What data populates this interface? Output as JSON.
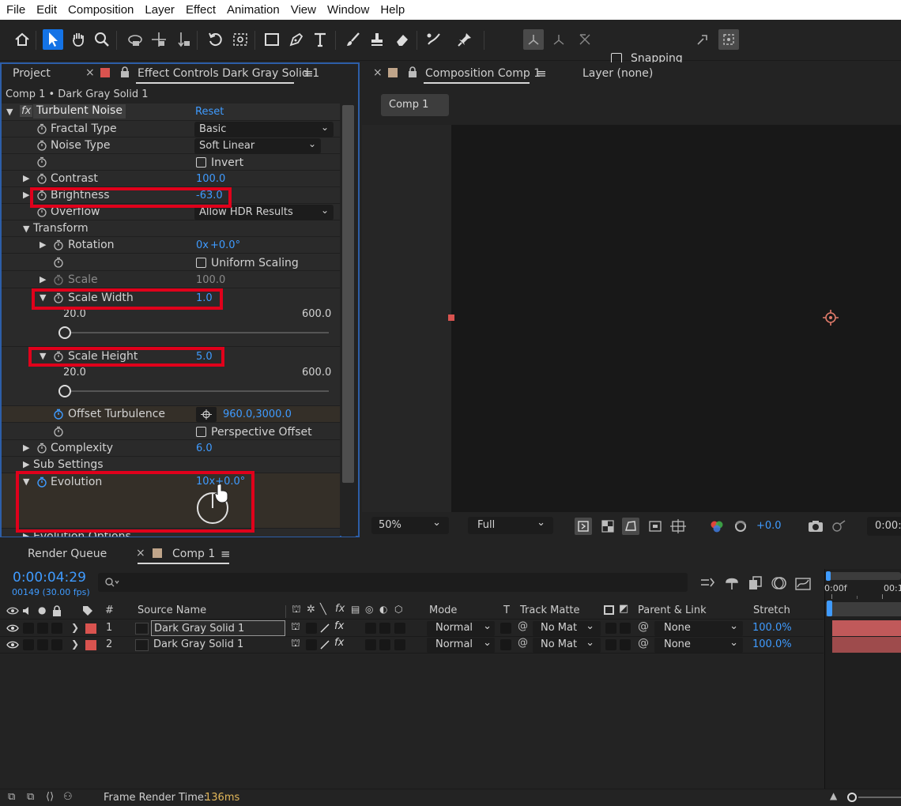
{
  "menu": [
    "File",
    "Edit",
    "Composition",
    "Layer",
    "Effect",
    "Animation",
    "View",
    "Window",
    "Help"
  ],
  "toolbar": {
    "snapping_label": "Snapping"
  },
  "left_panel": {
    "tab_project": "Project",
    "tab_effect_controls": "Effect Controls Dark Gray Solid 1",
    "breadcrumb": "Comp 1 • Dark Gray Solid 1"
  },
  "effect": {
    "name": "Turbulent Noise",
    "fx_label": "fx",
    "reset_label": "Reset",
    "fractal_type": {
      "label": "Fractal Type",
      "value": "Basic"
    },
    "noise_type": {
      "label": "Noise Type",
      "value": "Soft Linear"
    },
    "invert": {
      "label": "Invert",
      "checked": false
    },
    "contrast": {
      "label": "Contrast",
      "value": "100.0"
    },
    "brightness": {
      "label": "Brightness",
      "value": "-63.0"
    },
    "overflow": {
      "label": "Overflow",
      "value": "Allow HDR Results"
    },
    "transform": {
      "label": "Transform"
    },
    "rotation": {
      "label": "Rotation",
      "value_prefix": "0x",
      "value_suffix": "+0.0°"
    },
    "uniform_scaling": {
      "label": "Uniform Scaling",
      "checked": false
    },
    "scale": {
      "label": "Scale",
      "value": "100.0"
    },
    "scale_width": {
      "label": "Scale Width",
      "value": "1.0",
      "min": "20.0",
      "max": "600.0",
      "slider_fraction": 0.0
    },
    "scale_height": {
      "label": "Scale Height",
      "value": "5.0",
      "min": "20.0",
      "max": "600.0",
      "slider_fraction": 0.0
    },
    "offset_turbulence": {
      "label": "Offset Turbulence",
      "value": "960.0,3000.0"
    },
    "perspective_offset": {
      "label": "Perspective Offset",
      "checked": false
    },
    "complexity": {
      "label": "Complexity",
      "value": "6.0"
    },
    "sub_settings": {
      "label": "Sub Settings"
    },
    "evolution": {
      "label": "Evolution",
      "value": "10x+0.0°"
    },
    "evolution_options": {
      "label": "Evolution Options"
    }
  },
  "comp_panel": {
    "tab_label": "Composition Comp 1",
    "layer_tab": "Layer (none)",
    "comp_button": "Comp 1",
    "zoom": "50%",
    "resolution": "Full",
    "exposure": "+0.0",
    "timecode": "0:00:0"
  },
  "timeline": {
    "tab_render_queue": "Render Queue",
    "tab_comp": "Comp 1",
    "timecode": "0:00:04:29",
    "frame_info": "00149 (30.00 fps)",
    "search_placeholder": "",
    "headers": {
      "num": "#",
      "source_name": "Source Name",
      "mode": "Mode",
      "t": "T",
      "track_matte": "Track Matte",
      "parent_link": "Parent & Link",
      "stretch": "Stretch"
    },
    "ruler": [
      "0:00f",
      "00:1"
    ],
    "layers": [
      {
        "num": "1",
        "name": "Dark Gray Solid 1",
        "mode": "Normal",
        "matte": "No Mat",
        "parent": "None",
        "stretch": "100.0%",
        "selected": true
      },
      {
        "num": "2",
        "name": "Dark Gray Solid 1",
        "mode": "Normal",
        "matte": "No Mat",
        "parent": "None",
        "stretch": "100.0%",
        "selected": false
      }
    ],
    "footer_label": "Frame Render Time:",
    "footer_value": "136ms"
  },
  "colors": {
    "accent_blue": "#3f9bff",
    "highlight_red": "#e0001b",
    "label_red": "#d9534f",
    "solid_swatch": "#c0a58a"
  }
}
